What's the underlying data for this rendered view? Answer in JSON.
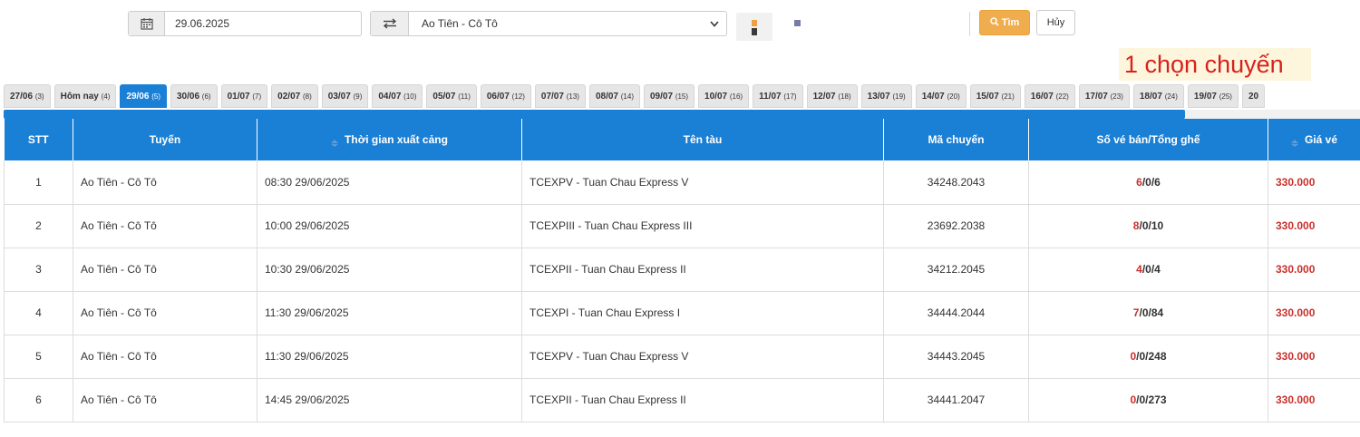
{
  "filter": {
    "date_value": "29.06.2025",
    "route_selected": "Ao Tiên - Cô Tô",
    "search_label": "Tìm",
    "cancel_label": "Hủy"
  },
  "annotation": "1 chọn chuyến",
  "day_tabs": [
    {
      "label": "27/06",
      "count": "(3)"
    },
    {
      "label": "Hôm nay",
      "count": "(4)"
    },
    {
      "label": "29/06",
      "count": "(5)",
      "active": true
    },
    {
      "label": "30/06",
      "count": "(6)"
    },
    {
      "label": "01/07",
      "count": "(7)"
    },
    {
      "label": "02/07",
      "count": "(8)"
    },
    {
      "label": "03/07",
      "count": "(9)"
    },
    {
      "label": "04/07",
      "count": "(10)"
    },
    {
      "label": "05/07",
      "count": "(11)"
    },
    {
      "label": "06/07",
      "count": "(12)"
    },
    {
      "label": "07/07",
      "count": "(13)"
    },
    {
      "label": "08/07",
      "count": "(14)"
    },
    {
      "label": "09/07",
      "count": "(15)"
    },
    {
      "label": "10/07",
      "count": "(16)"
    },
    {
      "label": "11/07",
      "count": "(17)"
    },
    {
      "label": "12/07",
      "count": "(18)"
    },
    {
      "label": "13/07",
      "count": "(19)"
    },
    {
      "label": "14/07",
      "count": "(20)"
    },
    {
      "label": "15/07",
      "count": "(21)"
    },
    {
      "label": "16/07",
      "count": "(22)"
    },
    {
      "label": "17/07",
      "count": "(23)"
    },
    {
      "label": "18/07",
      "count": "(24)"
    },
    {
      "label": "19/07",
      "count": "(25)"
    },
    {
      "label": "20",
      "count": ""
    }
  ],
  "table": {
    "headers": [
      "STT",
      "Tuyến",
      "Thời gian xuất cảng",
      "Tên tàu",
      "Mã chuyến",
      "Số vé bán/Tổng ghế",
      "Giá vé"
    ],
    "rows": [
      {
        "stt": "1",
        "route": "Ao Tiên - Cô Tô",
        "time": "08:30 29/06/2025",
        "ship": "TCEXPV - Tuan Chau Express V",
        "code": "34248.2043",
        "sold": "6",
        "seats": "/0/6",
        "price": "330.000"
      },
      {
        "stt": "2",
        "route": "Ao Tiên - Cô Tô",
        "time": "10:00 29/06/2025",
        "ship": "TCEXPIII - Tuan Chau Express III",
        "code": "23692.2038",
        "sold": "8",
        "seats": "/0/10",
        "price": "330.000"
      },
      {
        "stt": "3",
        "route": "Ao Tiên - Cô Tô",
        "time": "10:30 29/06/2025",
        "ship": "TCEXPII - Tuan Chau Express II",
        "code": "34212.2045",
        "sold": "4",
        "seats": "/0/4",
        "price": "330.000"
      },
      {
        "stt": "4",
        "route": "Ao Tiên - Cô Tô",
        "time": "11:30 29/06/2025",
        "ship": "TCEXPI - Tuan Chau Express I",
        "code": "34444.2044",
        "sold": "7",
        "seats": "/0/84",
        "price": "330.000"
      },
      {
        "stt": "5",
        "route": "Ao Tiên - Cô Tô",
        "time": "11:30 29/06/2025",
        "ship": "TCEXPV - Tuan Chau Express V",
        "code": "34443.2045",
        "sold": "0",
        "seats": "/0/248",
        "price": "330.000"
      },
      {
        "stt": "6",
        "route": "Ao Tiên - Cô Tô",
        "time": "14:45 29/06/2025",
        "ship": "TCEXPII - Tuan Chau Express II",
        "code": "34441.2047",
        "sold": "0",
        "seats": "/0/273",
        "price": "330.000"
      }
    ]
  },
  "colors": {
    "primary": "#1a80d6",
    "search_button": "#f0ad4e",
    "price_red": "#c9302c",
    "annotation_red": "#d9211c"
  }
}
